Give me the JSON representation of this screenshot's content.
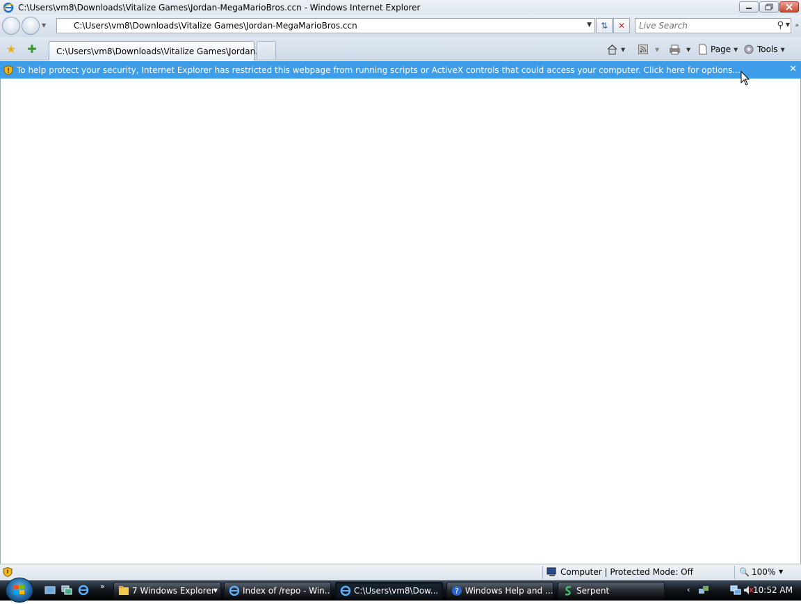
{
  "window": {
    "title": "C:\\Users\\vm8\\Downloads\\Vitalize Games\\Jordan-MegaMarioBros.ccn - Windows Internet Explorer"
  },
  "address": {
    "url": "C:\\Users\\vm8\\Downloads\\Vitalize Games\\Jordan-MegaMarioBros.ccn"
  },
  "search": {
    "placeholder": "Live Search"
  },
  "tab": {
    "label": "C:\\Users\\vm8\\Downloads\\Vitalize Games\\Jordan..."
  },
  "commands": {
    "page": "Page",
    "tools": "Tools"
  },
  "infobar": {
    "message": "To help protect your security, Internet Explorer has restricted this webpage from running scripts or ActiveX controls that could access your computer. Click here for options..."
  },
  "status": {
    "zone": "Computer | Protected Mode: Off",
    "zoom": "100%"
  },
  "taskbar": {
    "items": [
      {
        "label": "7 Windows Explorer"
      },
      {
        "label": "Index of /repo - Win..."
      },
      {
        "label": "C:\\Users\\vm8\\Dow..."
      },
      {
        "label": "Windows Help and ..."
      },
      {
        "label": "Serpent"
      }
    ],
    "clock": "10:52 AM"
  },
  "colors": {
    "infobar": "#3e9de8",
    "taskbar": "#11161d",
    "chrome": "#dfe6ee"
  }
}
